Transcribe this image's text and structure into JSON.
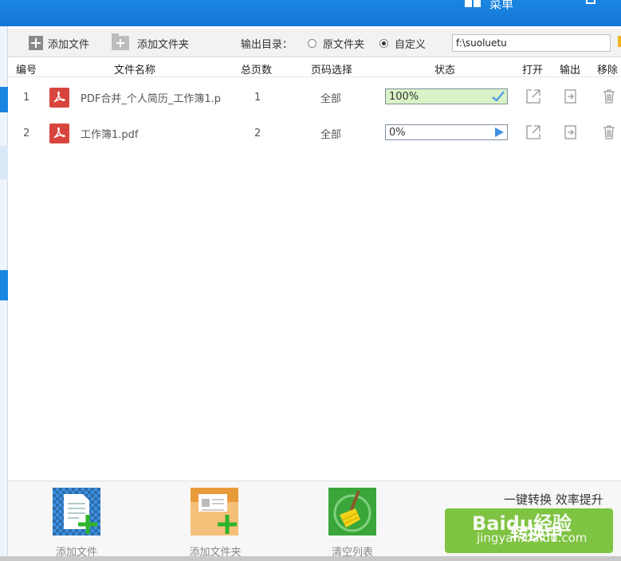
{
  "titlebar": {
    "menu_label": "菜单"
  },
  "toolbar": {
    "add_file_label": "添加文件",
    "add_folder_label": "添加文件夹",
    "output_dir_label": "输出目录：",
    "option_original_label": "原文件夹",
    "option_custom_label": "自定义",
    "selected_option": "自定义",
    "output_path": "f:\\suoluetu"
  },
  "table": {
    "headers": {
      "index": "编号",
      "filename": "文件名称",
      "pages": "总页数",
      "page_select": "页码选择",
      "status": "状态",
      "open": "打开",
      "export": "输出",
      "remove": "移除"
    },
    "rows": [
      {
        "index": "1",
        "filename": "PDF合并_个人简历_工作簿1.p",
        "pages": "1",
        "page_select": "全部",
        "status": "100%",
        "progress": 1.0
      },
      {
        "index": "2",
        "filename": "工作簿1.pdf",
        "pages": "2",
        "page_select": "全部",
        "status": "0%",
        "progress": 0.0
      }
    ]
  },
  "bottom": {
    "add_file_label": "添加文件",
    "add_folder_label": "添加文件夹",
    "clear_list_label": "清空列表",
    "slogan": "一键转换  效率提升",
    "convert_label": "转换中",
    "watermark_logo": "Baidu经验",
    "watermark_url": "jingyan.baidu.com"
  },
  "colors": {
    "title_blue": "#1a86e2",
    "convert_green": "#7fc342",
    "pdf_red": "#d8453e",
    "progress_fill": "#d9f2c6"
  }
}
